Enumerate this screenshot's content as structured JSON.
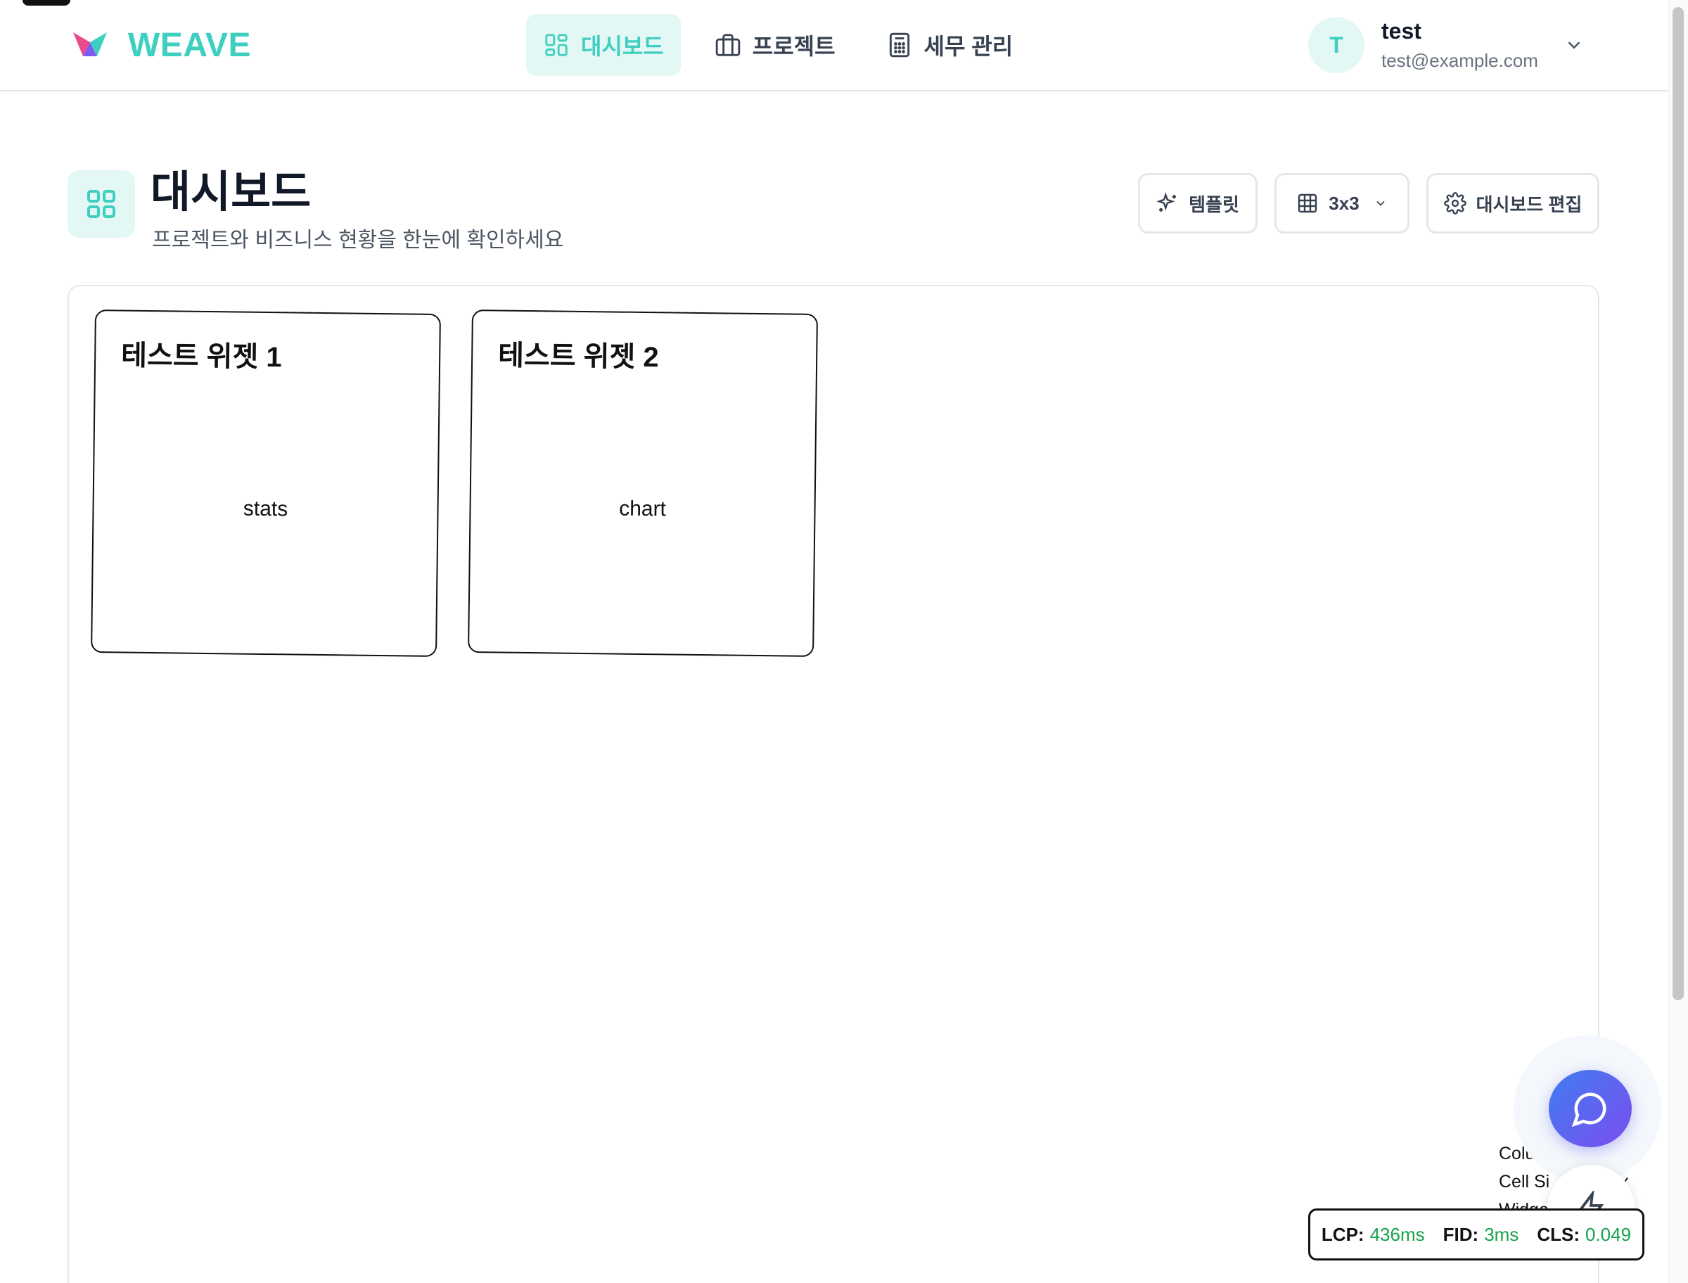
{
  "app": {
    "name": "WEAVE",
    "brand_color": "#3fcfc0",
    "accent_gradient": [
      "#3f7df0",
      "#7c4df0"
    ]
  },
  "nav": {
    "items": [
      {
        "label": "대시보드",
        "icon": "layout-grid-icon",
        "active": true
      },
      {
        "label": "프로젝트",
        "icon": "briefcase-icon",
        "active": false
      },
      {
        "label": "세무 관리",
        "icon": "calculator-icon",
        "active": false
      }
    ]
  },
  "user": {
    "initial": "T",
    "name": "test",
    "email": "test@example.com"
  },
  "page": {
    "title": "대시보드",
    "subtitle": "프로젝트와 비즈니스 현황을 한눈에 확인하세요"
  },
  "toolbar": {
    "template_label": "템플릿",
    "grid_label": "3x3",
    "edit_label": "대시보드 편집"
  },
  "widgets": [
    {
      "title": "테스트 위젯 1",
      "type": "stats"
    },
    {
      "title": "테스트 위젯 2",
      "type": "chart"
    }
  ],
  "debug": {
    "columns": "Columns: 4",
    "cell_size": "Cell Si",
    "cell_size_suffix": "x",
    "widgets": "Widge"
  },
  "vitals": {
    "lcp_label": "LCP:",
    "lcp_value": "436ms",
    "fid_label": "FID:",
    "fid_value": "3ms",
    "cls_label": "CLS:",
    "cls_value": "0.049",
    "good_color": "#16a34a"
  }
}
